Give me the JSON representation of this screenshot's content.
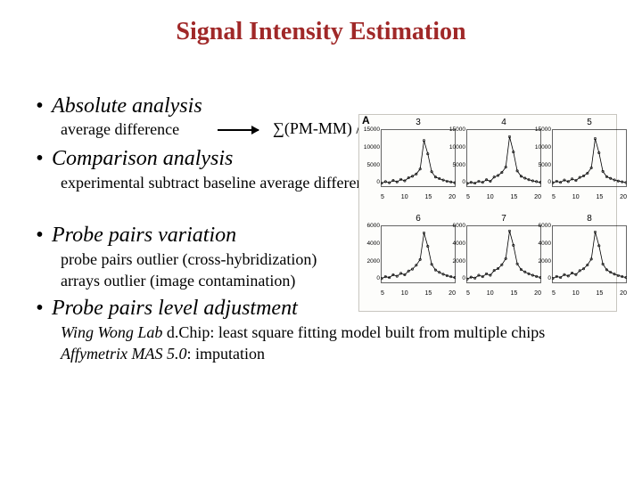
{
  "title": "Signal Intensity Estimation",
  "bullets": {
    "b1": "Absolute analysis",
    "b1_sub_label": "average difference",
    "b1_formula": "∑(PM-MM) / n",
    "b2": "Comparison analysis",
    "b2_sub": "experimental subtract baseline average difference",
    "b3": "Probe pairs variation",
    "b3_sub1": "probe pairs outlier (cross-hybridization)",
    "b3_sub2": "arrays outlier (image contamination)",
    "b4": "Probe pairs level adjustment",
    "b4_sub1_it": "Wing Wong Lab",
    "b4_sub1_rest": " d.Chip: least square fitting model built from multiple chips",
    "b4_sub2_it": "Affymetrix MAS 5.0",
    "b4_sub2_rest": ": imputation"
  },
  "chart_data": [
    {
      "id": "3",
      "type": "line",
      "title": "3",
      "x_ticks": [
        5,
        10,
        15,
        20
      ],
      "y_ticks": [
        0,
        5000,
        10000,
        15000
      ],
      "ylim": [
        0,
        15000
      ],
      "xlim": [
        1,
        20
      ],
      "x": [
        1,
        2,
        3,
        4,
        5,
        6,
        7,
        8,
        9,
        10,
        11,
        12,
        13,
        14,
        15,
        16,
        17,
        18,
        19,
        20
      ],
      "values": [
        800,
        1200,
        900,
        1500,
        1100,
        1800,
        1400,
        2200,
        2600,
        3200,
        4500,
        12000,
        8500,
        3800,
        2400,
        2000,
        1600,
        1300,
        1100,
        900
      ]
    },
    {
      "id": "4",
      "type": "line",
      "title": "4",
      "x_ticks": [
        5,
        10,
        15,
        20
      ],
      "y_ticks": [
        0,
        5000,
        10000,
        15000
      ],
      "ylim": [
        0,
        15000
      ],
      "xlim": [
        1,
        20
      ],
      "x": [
        1,
        2,
        3,
        4,
        5,
        6,
        7,
        8,
        9,
        10,
        11,
        12,
        13,
        14,
        15,
        16,
        17,
        18,
        19,
        20
      ],
      "values": [
        700,
        1000,
        800,
        1300,
        1000,
        1700,
        1300,
        2400,
        2800,
        3600,
        5000,
        13000,
        9000,
        4000,
        2600,
        2100,
        1700,
        1400,
        1200,
        1000
      ]
    },
    {
      "id": "5",
      "type": "line",
      "title": "5",
      "x_ticks": [
        5,
        10,
        15,
        20
      ],
      "y_ticks": [
        0,
        5000,
        10000,
        15000
      ],
      "ylim": [
        0,
        15000
      ],
      "xlim": [
        1,
        20
      ],
      "x": [
        1,
        2,
        3,
        4,
        5,
        6,
        7,
        8,
        9,
        10,
        11,
        12,
        13,
        14,
        15,
        16,
        17,
        18,
        19,
        20
      ],
      "values": [
        900,
        1300,
        1000,
        1600,
        1200,
        1900,
        1500,
        2300,
        2700,
        3400,
        4800,
        12500,
        8800,
        3900,
        2500,
        2050,
        1650,
        1350,
        1150,
        950
      ]
    },
    {
      "id": "6",
      "type": "line",
      "title": "6",
      "x_ticks": [
        5,
        10,
        15,
        20
      ],
      "y_ticks": [
        0,
        2000,
        4000,
        6000
      ],
      "ylim": [
        0,
        6000
      ],
      "xlim": [
        1,
        20
      ],
      "x": [
        1,
        2,
        3,
        4,
        5,
        6,
        7,
        8,
        9,
        10,
        11,
        12,
        13,
        14,
        15,
        16,
        17,
        18,
        19,
        20
      ],
      "values": [
        400,
        600,
        500,
        800,
        650,
        950,
        800,
        1200,
        1400,
        1800,
        2400,
        5200,
        3800,
        1900,
        1300,
        1050,
        850,
        700,
        600,
        500
      ]
    },
    {
      "id": "7",
      "type": "line",
      "title": "7",
      "x_ticks": [
        5,
        10,
        15,
        20
      ],
      "y_ticks": [
        0,
        2000,
        4000,
        6000
      ],
      "ylim": [
        0,
        6000
      ],
      "xlim": [
        1,
        20
      ],
      "x": [
        1,
        2,
        3,
        4,
        5,
        6,
        7,
        8,
        9,
        10,
        11,
        12,
        13,
        14,
        15,
        16,
        17,
        18,
        19,
        20
      ],
      "values": [
        350,
        550,
        450,
        750,
        600,
        900,
        750,
        1250,
        1450,
        1850,
        2500,
        5400,
        3900,
        1950,
        1350,
        1100,
        900,
        750,
        620,
        520
      ]
    },
    {
      "id": "8",
      "type": "line",
      "title": "8",
      "x_ticks": [
        5,
        10,
        15,
        20
      ],
      "y_ticks": [
        0,
        2000,
        4000,
        6000
      ],
      "ylim": [
        0,
        6000
      ],
      "xlim": [
        1,
        20
      ],
      "x": [
        1,
        2,
        3,
        4,
        5,
        6,
        7,
        8,
        9,
        10,
        11,
        12,
        13,
        14,
        15,
        16,
        17,
        18,
        19,
        20
      ],
      "values": [
        420,
        620,
        520,
        820,
        670,
        980,
        820,
        1230,
        1430,
        1830,
        2450,
        5300,
        3850,
        1920,
        1320,
        1070,
        870,
        720,
        610,
        510
      ]
    }
  ],
  "panel_label": "A"
}
